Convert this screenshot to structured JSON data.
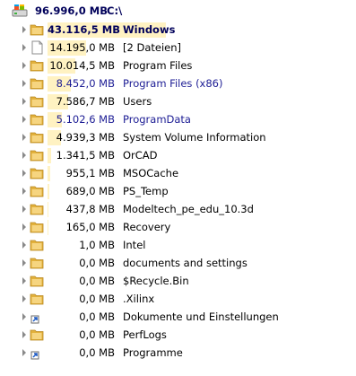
{
  "root": {
    "size": "96.996,0 MB",
    "path": "C:\\",
    "icon": "drive-icon"
  },
  "items": [
    {
      "size": "43.116,5 MB",
      "name": "Windows",
      "icon": "folder-icon",
      "fraction": 0.4445,
      "style": "bold"
    },
    {
      "size": "14.195,0 MB",
      "name": "[2 Dateien]",
      "icon": "file-icon",
      "fraction": 0.1463,
      "style": "normal"
    },
    {
      "size": "10.014,5 MB",
      "name": "Program Files",
      "icon": "folder-icon",
      "fraction": 0.1032,
      "style": "normal"
    },
    {
      "size": "8.452,0 MB",
      "name": "Program Files (x86)",
      "icon": "folder-icon",
      "fraction": 0.0871,
      "style": "blue"
    },
    {
      "size": "7.586,7 MB",
      "name": "Users",
      "icon": "folder-icon",
      "fraction": 0.0782,
      "style": "normal"
    },
    {
      "size": "5.102,6 MB",
      "name": "ProgramData",
      "icon": "folder-icon",
      "fraction": 0.0526,
      "style": "blue"
    },
    {
      "size": "4.939,3 MB",
      "name": "System Volume Information",
      "icon": "folder-icon",
      "fraction": 0.0509,
      "style": "normal"
    },
    {
      "size": "1.341,5 MB",
      "name": "OrCAD",
      "icon": "folder-icon",
      "fraction": 0.0138,
      "style": "normal"
    },
    {
      "size": "955,1 MB",
      "name": "MSOCache",
      "icon": "folder-icon",
      "fraction": 0.0098,
      "style": "normal"
    },
    {
      "size": "689,0 MB",
      "name": "PS_Temp",
      "icon": "folder-icon",
      "fraction": 0.0071,
      "style": "normal"
    },
    {
      "size": "437,8 MB",
      "name": "Modeltech_pe_edu_10.3d",
      "icon": "folder-icon",
      "fraction": 0.0045,
      "style": "normal"
    },
    {
      "size": "165,0 MB",
      "name": "Recovery",
      "icon": "folder-icon",
      "fraction": 0.0017,
      "style": "normal"
    },
    {
      "size": "1,0 MB",
      "name": "Intel",
      "icon": "folder-icon",
      "fraction": 0.0,
      "style": "normal"
    },
    {
      "size": "0,0 MB",
      "name": "documents and settings",
      "icon": "folder-icon",
      "fraction": 0.0,
      "style": "normal"
    },
    {
      "size": "0,0 MB",
      "name": "$Recycle.Bin",
      "icon": "folder-icon",
      "fraction": 0.0,
      "style": "normal"
    },
    {
      "size": "0,0 MB",
      "name": ".Xilinx",
      "icon": "folder-icon",
      "fraction": 0.0,
      "style": "normal"
    },
    {
      "size": "0,0 MB",
      "name": "Dokumente und Einstellungen",
      "icon": "shortcut-icon",
      "fraction": 0.0,
      "style": "normal"
    },
    {
      "size": "0,0 MB",
      "name": "PerfLogs",
      "icon": "folder-icon",
      "fraction": 0.0,
      "style": "normal"
    },
    {
      "size": "0,0 MB",
      "name": "Programme",
      "icon": "shortcut-icon",
      "fraction": 0.0,
      "style": "normal"
    }
  ]
}
